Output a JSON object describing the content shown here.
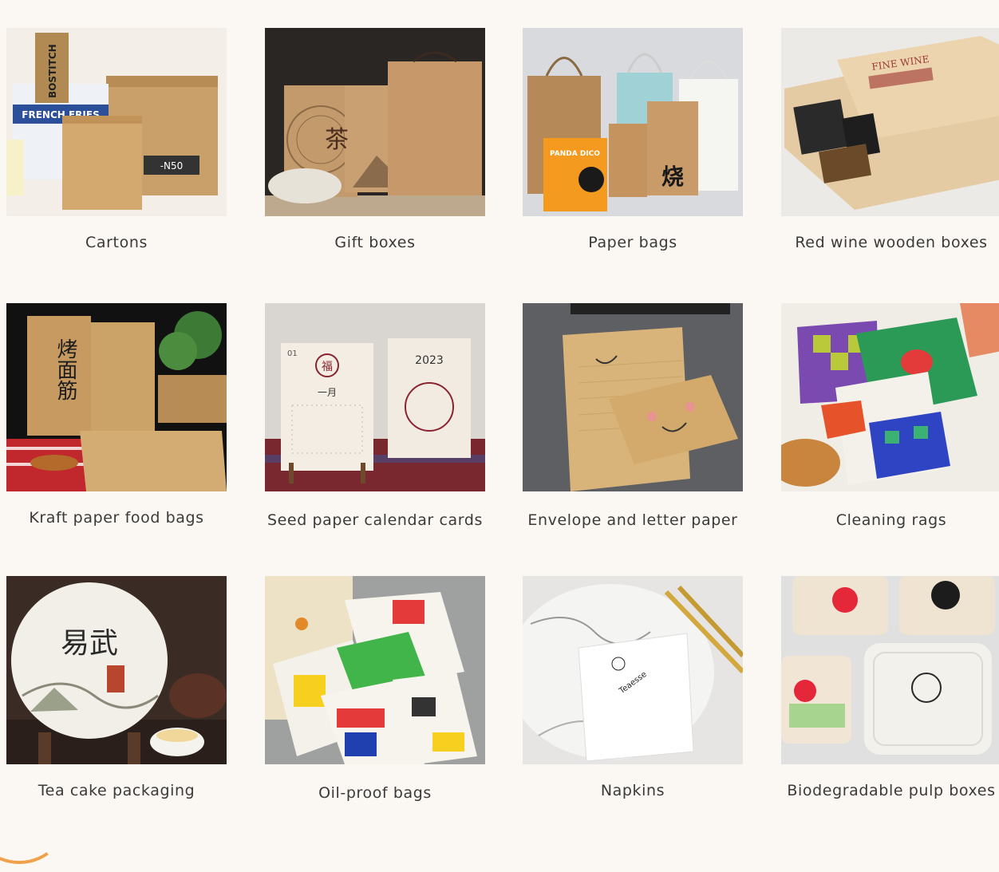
{
  "products": [
    {
      "label": "Cartons",
      "icon": "cartons-photo"
    },
    {
      "label": "Gift boxes",
      "icon": "gift-boxes-photo"
    },
    {
      "label": "Paper bags",
      "icon": "paper-bags-photo"
    },
    {
      "label": "Red wine wooden boxes",
      "icon": "wine-box-photo"
    },
    {
      "label": "Kraft paper food bags",
      "icon": "kraft-food-bags-photo"
    },
    {
      "label": "Seed paper calendar cards",
      "icon": "calendar-cards-photo"
    },
    {
      "label": "Envelope and letter paper",
      "icon": "envelope-photo"
    },
    {
      "label": "Cleaning rags",
      "icon": "cleaning-rags-photo"
    },
    {
      "label": "Tea cake packaging",
      "icon": "tea-cake-photo"
    },
    {
      "label": "Oil-proof bags",
      "icon": "oil-proof-bags-photo"
    },
    {
      "label": "Napkins",
      "icon": "napkins-photo"
    },
    {
      "label": "Biodegradable pulp boxes",
      "icon": "pulp-boxes-photo"
    }
  ],
  "photo_text": {
    "cartons_brand": "BOSTITCH",
    "cartons_fries": "FRENCH FRIES",
    "cartons_code": "-N50",
    "gift_tea": "茶",
    "bags_panda": "PANDA DICO",
    "bags_char": "烧",
    "wine_title": "FINE WINE",
    "kraft_chars": "烤面筋",
    "cal_month_num": "01",
    "cal_fu": "福",
    "cal_month": "一月",
    "cal_year": "2023",
    "tea_chars": "易武",
    "napkin_brand": "Teaesse"
  },
  "colors": {
    "background": "#fbf8f4",
    "label": "#3a3a3a",
    "accent": "#f0a24a"
  }
}
